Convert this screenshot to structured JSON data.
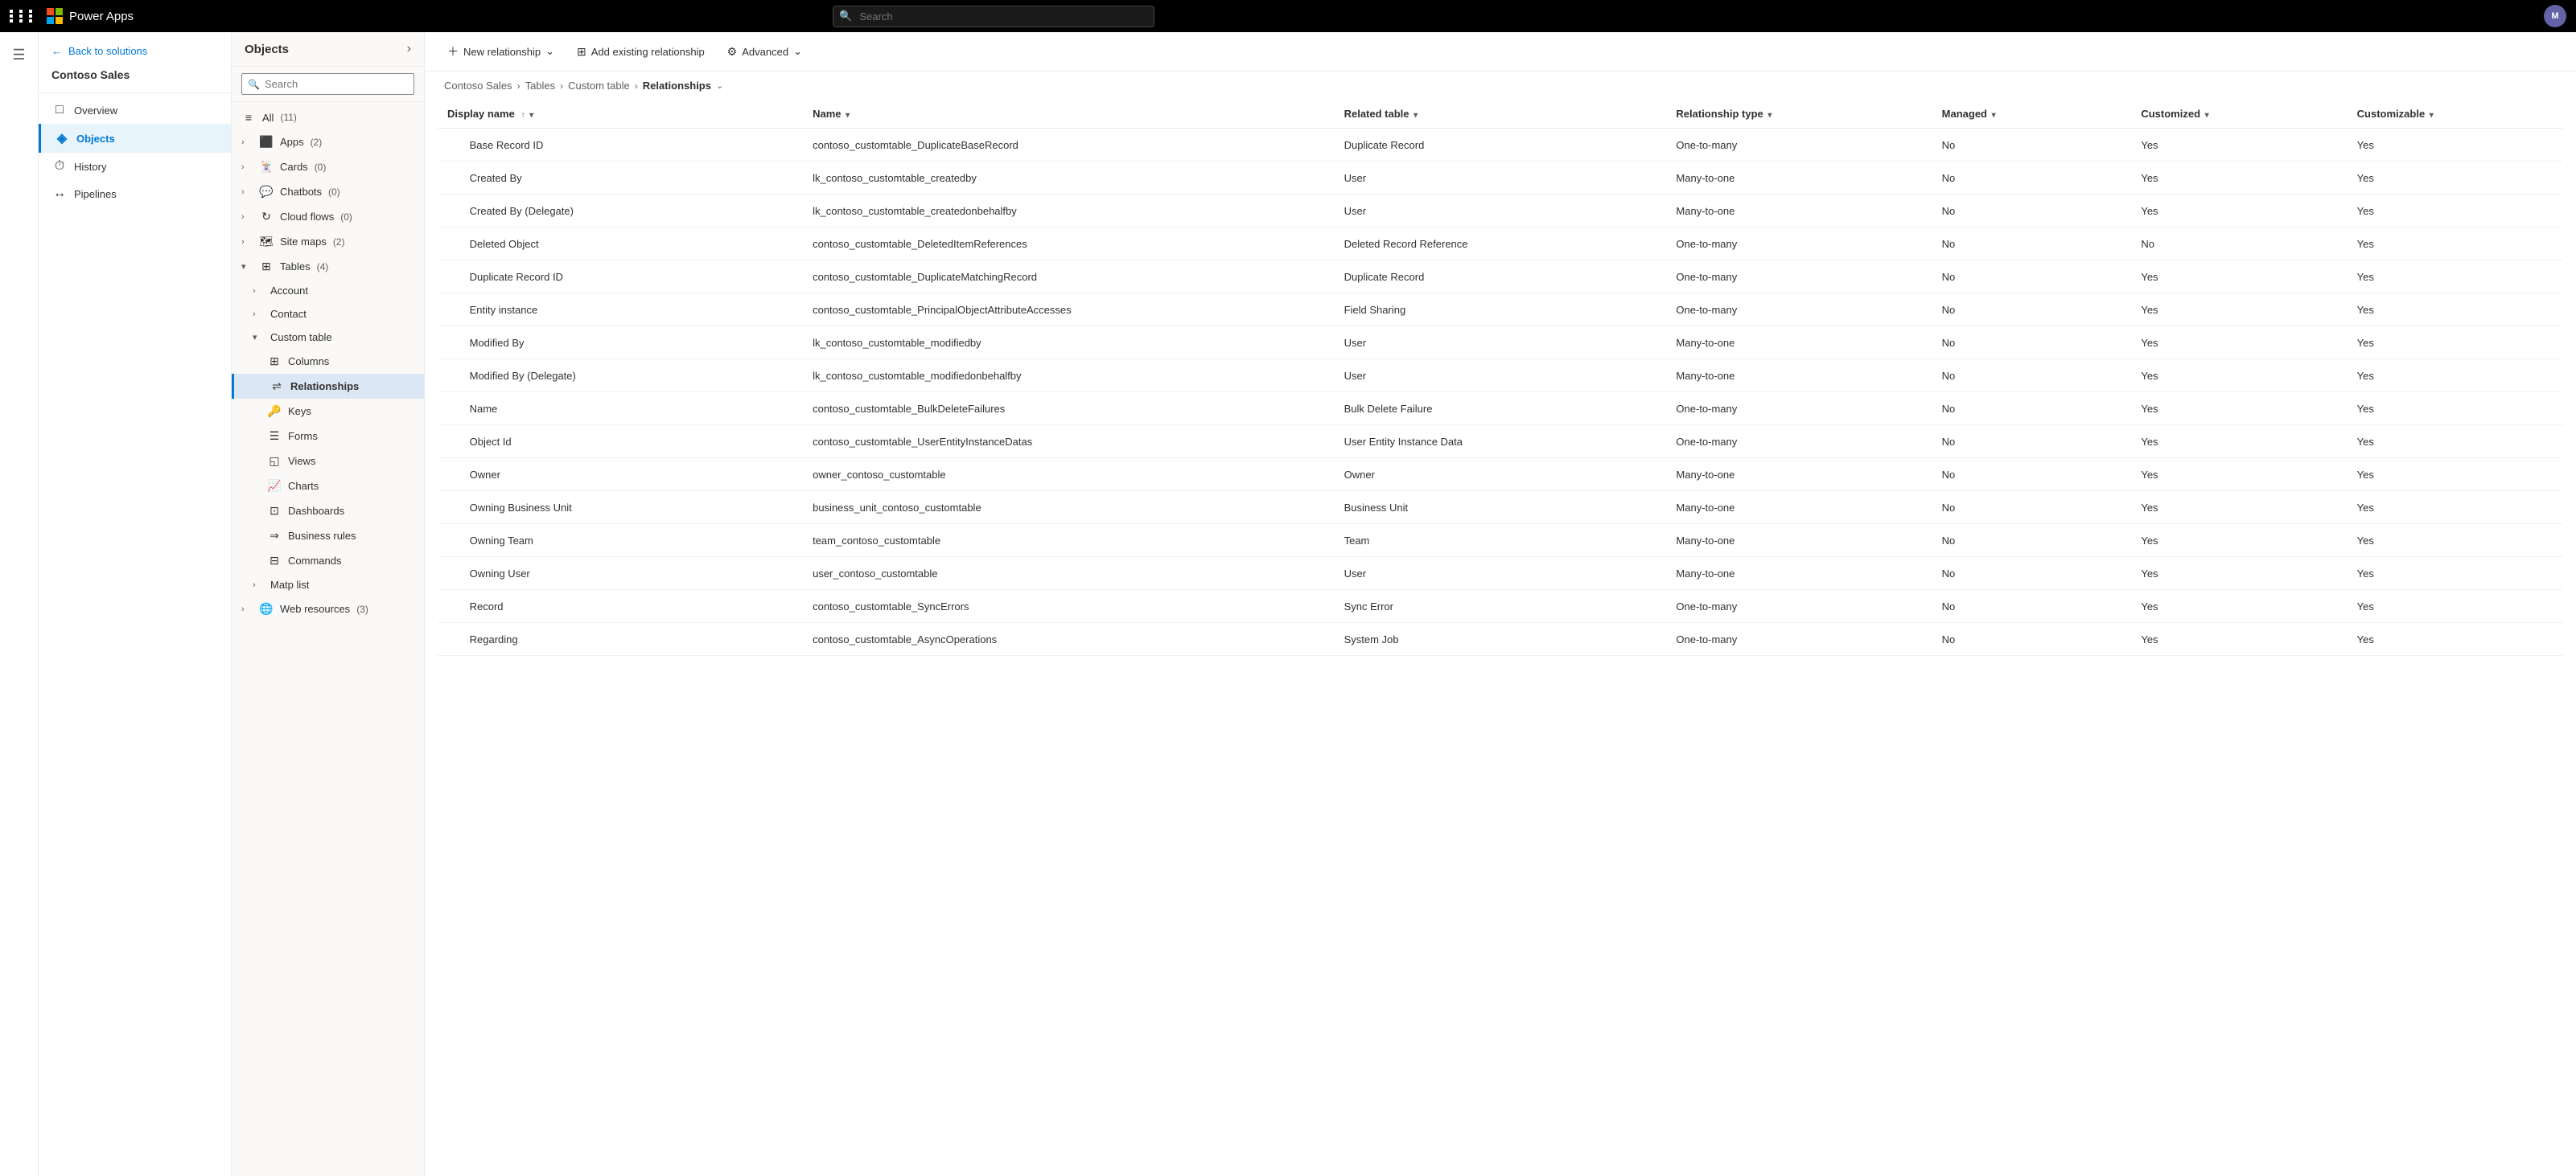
{
  "topbar": {
    "app_name": "Power Apps",
    "search_placeholder": "Search",
    "avatar_initials": "M"
  },
  "sidebar": {
    "solution_name": "Contoso Sales",
    "back_label": "Back to solutions",
    "items": [
      {
        "id": "overview",
        "label": "Overview",
        "icon": "□"
      },
      {
        "id": "objects",
        "label": "Objects",
        "icon": "◈",
        "active": true
      },
      {
        "id": "history",
        "label": "History",
        "icon": "⏱"
      },
      {
        "id": "pipelines",
        "label": "Pipelines",
        "icon": "↔"
      }
    ]
  },
  "objects_panel": {
    "title": "Objects",
    "search_placeholder": "Search",
    "items": [
      {
        "id": "all",
        "label": "All",
        "count": "(11)",
        "icon": "≡",
        "indent": 0
      },
      {
        "id": "apps",
        "label": "Apps",
        "count": "(2)",
        "icon": "⬛",
        "indent": 0
      },
      {
        "id": "cards",
        "label": "Cards",
        "count": "(0)",
        "icon": "🃏",
        "indent": 0
      },
      {
        "id": "chatbots",
        "label": "Chatbots",
        "count": "(0)",
        "icon": "💬",
        "indent": 0
      },
      {
        "id": "cloudflows",
        "label": "Cloud flows",
        "count": "(0)",
        "icon": "↻",
        "indent": 0
      },
      {
        "id": "sitemaps",
        "label": "Site maps",
        "count": "(2)",
        "icon": "🗺",
        "indent": 0
      },
      {
        "id": "tables",
        "label": "Tables",
        "count": "(4)",
        "icon": "⊞",
        "indent": 0,
        "expanded": true
      },
      {
        "id": "account",
        "label": "Account",
        "icon": "",
        "indent": 1
      },
      {
        "id": "contact",
        "label": "Contact",
        "icon": "",
        "indent": 1
      },
      {
        "id": "customtable",
        "label": "Custom table",
        "icon": "",
        "indent": 1,
        "expanded": true
      },
      {
        "id": "columns",
        "label": "Columns",
        "icon": "⊞",
        "indent": 2
      },
      {
        "id": "relationships",
        "label": "Relationships",
        "icon": "⇌",
        "indent": 2,
        "active": true
      },
      {
        "id": "keys",
        "label": "Keys",
        "icon": "🔑",
        "indent": 2
      },
      {
        "id": "forms",
        "label": "Forms",
        "icon": "☰",
        "indent": 2
      },
      {
        "id": "views",
        "label": "Views",
        "icon": "◱",
        "indent": 2
      },
      {
        "id": "charts",
        "label": "Charts",
        "icon": "📈",
        "indent": 2
      },
      {
        "id": "dashboards",
        "label": "Dashboards",
        "icon": "⊡",
        "indent": 2
      },
      {
        "id": "businessrules",
        "label": "Business rules",
        "icon": "⇒",
        "indent": 2
      },
      {
        "id": "commands",
        "label": "Commands",
        "icon": "⊟",
        "indent": 2
      },
      {
        "id": "maplist",
        "label": "Matp list",
        "icon": "",
        "indent": 1
      },
      {
        "id": "webresources",
        "label": "Web resources",
        "count": "(3)",
        "icon": "🌐",
        "indent": 0
      }
    ]
  },
  "toolbar": {
    "new_relationship_label": "New relationship",
    "add_existing_label": "Add existing relationship",
    "advanced_label": "Advanced"
  },
  "breadcrumb": {
    "items": [
      {
        "id": "contoso",
        "label": "Contoso Sales",
        "link": true
      },
      {
        "id": "tables",
        "label": "Tables",
        "link": true
      },
      {
        "id": "customtable",
        "label": "Custom table",
        "link": true
      },
      {
        "id": "relationships",
        "label": "Relationships",
        "link": false,
        "current": true
      }
    ]
  },
  "table": {
    "columns": [
      {
        "id": "display_name",
        "label": "Display name",
        "sortable": true,
        "filtered": true
      },
      {
        "id": "name",
        "label": "Name",
        "sortable": true
      },
      {
        "id": "related_table",
        "label": "Related table",
        "sortable": true
      },
      {
        "id": "relationship_type",
        "label": "Relationship type",
        "sortable": true
      },
      {
        "id": "managed",
        "label": "Managed",
        "sortable": true
      },
      {
        "id": "customized",
        "label": "Customized",
        "sortable": true
      },
      {
        "id": "customizable",
        "label": "Customizable",
        "sortable": true
      }
    ],
    "rows": [
      {
        "display_name": "Base Record ID",
        "name": "contoso_customtable_DuplicateBaseRecord",
        "related_table": "Duplicate Record",
        "relationship_type": "One-to-many",
        "managed": "No",
        "customized": "Yes",
        "customizable": "Yes"
      },
      {
        "display_name": "Created By",
        "name": "lk_contoso_customtable_createdby",
        "related_table": "User",
        "relationship_type": "Many-to-one",
        "managed": "No",
        "customized": "Yes",
        "customizable": "Yes"
      },
      {
        "display_name": "Created By (Delegate)",
        "name": "lk_contoso_customtable_createdonbehalfby",
        "related_table": "User",
        "relationship_type": "Many-to-one",
        "managed": "No",
        "customized": "Yes",
        "customizable": "Yes"
      },
      {
        "display_name": "Deleted Object",
        "name": "contoso_customtable_DeletedItemReferences",
        "related_table": "Deleted Record Reference",
        "relationship_type": "One-to-many",
        "managed": "No",
        "customized": "No",
        "customizable": "Yes"
      },
      {
        "display_name": "Duplicate Record ID",
        "name": "contoso_customtable_DuplicateMatchingRecord",
        "related_table": "Duplicate Record",
        "relationship_type": "One-to-many",
        "managed": "No",
        "customized": "Yes",
        "customizable": "Yes"
      },
      {
        "display_name": "Entity instance",
        "name": "contoso_customtable_PrincipalObjectAttributeAccesses",
        "related_table": "Field Sharing",
        "relationship_type": "One-to-many",
        "managed": "No",
        "customized": "Yes",
        "customizable": "Yes"
      },
      {
        "display_name": "Modified By",
        "name": "lk_contoso_customtable_modifiedby",
        "related_table": "User",
        "relationship_type": "Many-to-one",
        "managed": "No",
        "customized": "Yes",
        "customizable": "Yes"
      },
      {
        "display_name": "Modified By (Delegate)",
        "name": "lk_contoso_customtable_modifiedonbehalfby",
        "related_table": "User",
        "relationship_type": "Many-to-one",
        "managed": "No",
        "customized": "Yes",
        "customizable": "Yes"
      },
      {
        "display_name": "Name",
        "name": "contoso_customtable_BulkDeleteFailures",
        "related_table": "Bulk Delete Failure",
        "relationship_type": "One-to-many",
        "managed": "No",
        "customized": "Yes",
        "customizable": "Yes"
      },
      {
        "display_name": "Object Id",
        "name": "contoso_customtable_UserEntityInstanceDatas",
        "related_table": "User Entity Instance Data",
        "relationship_type": "One-to-many",
        "managed": "No",
        "customized": "Yes",
        "customizable": "Yes"
      },
      {
        "display_name": "Owner",
        "name": "owner_contoso_customtable",
        "related_table": "Owner",
        "relationship_type": "Many-to-one",
        "managed": "No",
        "customized": "Yes",
        "customizable": "Yes"
      },
      {
        "display_name": "Owning Business Unit",
        "name": "business_unit_contoso_customtable",
        "related_table": "Business Unit",
        "relationship_type": "Many-to-one",
        "managed": "No",
        "customized": "Yes",
        "customizable": "Yes"
      },
      {
        "display_name": "Owning Team",
        "name": "team_contoso_customtable",
        "related_table": "Team",
        "relationship_type": "Many-to-one",
        "managed": "No",
        "customized": "Yes",
        "customizable": "Yes"
      },
      {
        "display_name": "Owning User",
        "name": "user_contoso_customtable",
        "related_table": "User",
        "relationship_type": "Many-to-one",
        "managed": "No",
        "customized": "Yes",
        "customizable": "Yes"
      },
      {
        "display_name": "Record",
        "name": "contoso_customtable_SyncErrors",
        "related_table": "Sync Error",
        "relationship_type": "One-to-many",
        "managed": "No",
        "customized": "Yes",
        "customizable": "Yes"
      },
      {
        "display_name": "Regarding",
        "name": "contoso_customtable_AsyncOperations",
        "related_table": "System Job",
        "relationship_type": "One-to-many",
        "managed": "No",
        "customized": "Yes",
        "customizable": "Yes"
      }
    ]
  }
}
